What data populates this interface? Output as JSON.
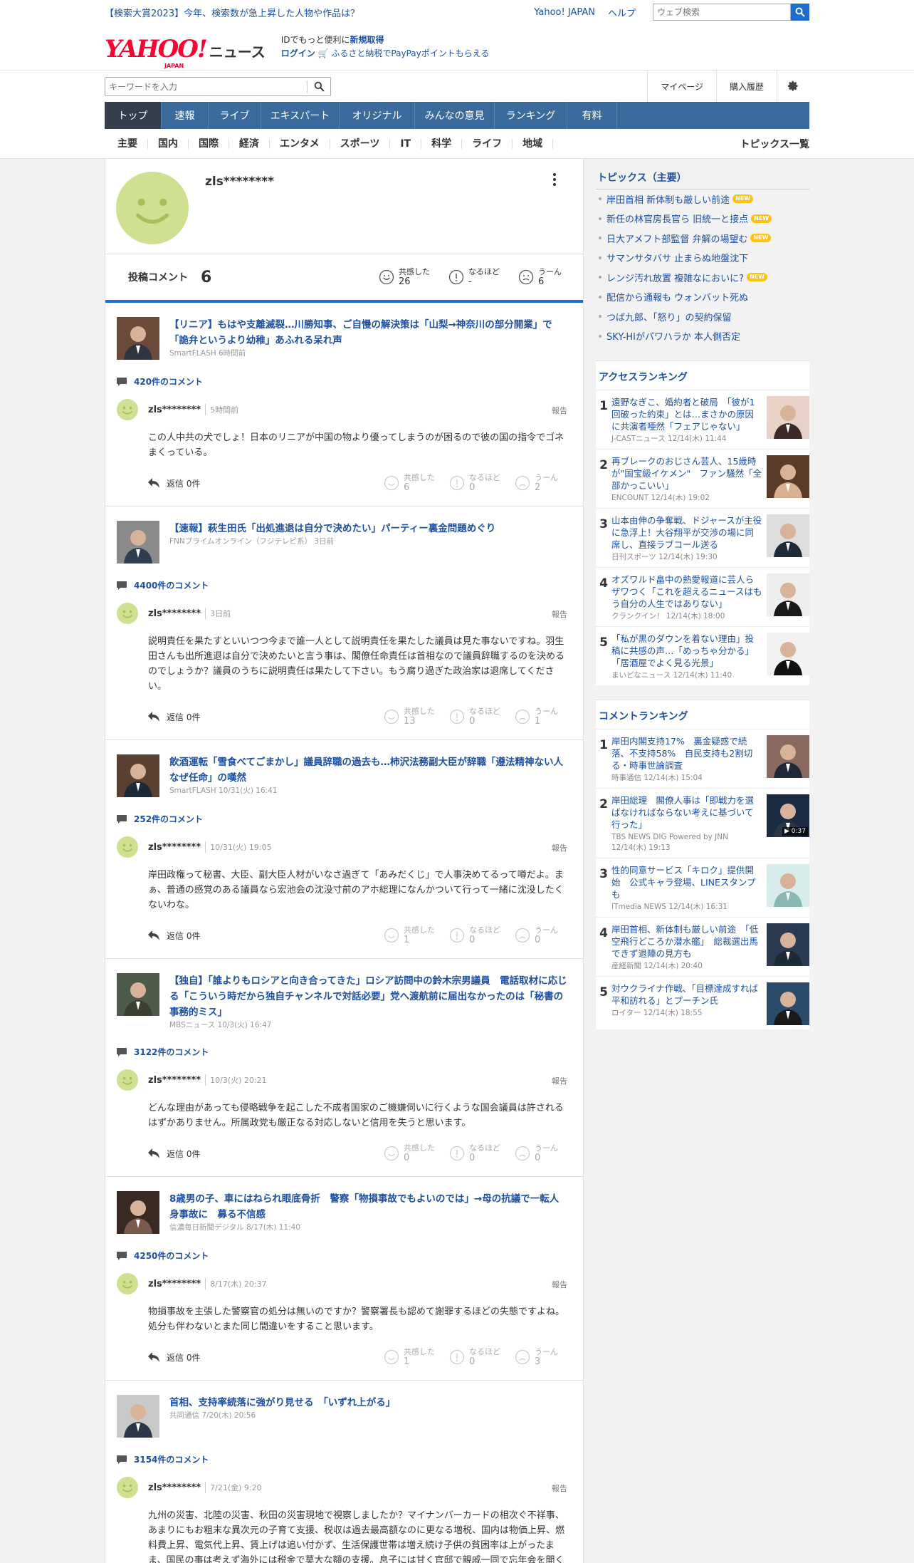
{
  "topbar": {
    "promo": "【検索大賞2023】今年、検索数が急上昇した人物や作品は？",
    "yahoo_japan": "Yahoo! JAPAN",
    "help": "ヘルプ",
    "web_search_placeholder": "ウェブ検索"
  },
  "header": {
    "logo": "YAHOO!",
    "logo_sub": "JAPAN",
    "logo_news": "ニュース",
    "id_line1_pre": "IDでもっと便利に",
    "id_line1_link": "新規取得",
    "login": "ログイン",
    "furusato": "ふるさと納税でPayPayポイントもらえる"
  },
  "search": {
    "placeholder": "キーワードを入力",
    "mypage": "マイページ",
    "history": "購入履歴"
  },
  "nav": {
    "tabs": [
      "トップ",
      "速報",
      "ライブ",
      "エキスパート",
      "オリジナル",
      "みんなの意見",
      "ランキング",
      "有料"
    ]
  },
  "subnav": {
    "items": [
      "主要",
      "国内",
      "国際",
      "経済",
      "エンタメ",
      "スポーツ",
      "IT",
      "科学",
      "ライフ",
      "地域"
    ],
    "more": "トピックス一覧"
  },
  "profile": {
    "name": "zls********",
    "posts_label": "投稿コメント",
    "posts_count": "6",
    "react1_label": "共感した",
    "react1_count": "26",
    "react2_label": "なるほど",
    "react2_count": "-",
    "react3_label": "うーん",
    "react3_count": "6"
  },
  "labels": {
    "report": "報告",
    "reply": "返信 0件",
    "r1": "共感した",
    "r2": "なるほど",
    "r3": "うーん"
  },
  "comments": [
    {
      "title": "【リニア】もはや支離滅裂…川勝知事、ご自慢の解決策は「山梨→神奈川の部分開業」で「詭弁というより幼稚」あふれる呆れ声",
      "source": "SmartFLASH 6時間前",
      "count": "420件のコメント",
      "user": "zls********",
      "time": "5時間前",
      "body": "この人中共の犬でしょ！日本のリニアが中国の物より優ってしまうのが困るので彼の国の指令でゴネまくっている。",
      "n1": "6",
      "n2": "0",
      "n3": "2"
    },
    {
      "title": "【速報】萩生田氏「出処進退は自分で決めたい」パーティー裏金問題めぐり",
      "source": "FNNプライムオンライン（フジテレビ系） 3日前",
      "count": "4400件のコメント",
      "user": "zls********",
      "time": "3日前",
      "body": "説明責任を果たすといいつつ今まで誰一人として説明責任を果たした議員は見た事ないですね。羽生田さんも出所進退は自分で決めたいと言う事は、閣僚任命責任は首相なので議員辞職するのを決めるのでしょうか？議員のうちに説明責任は果たして下さい。もう腐り過ぎた政治家は退席してください。",
      "n1": "13",
      "n2": "0",
      "n3": "1"
    },
    {
      "title": "飲酒運転「雪食べてごまかし」議員辞職の過去も…柿沢法務副大臣が辞職「遵法精神ない人なぜ任命」の嘆然",
      "source": "SmartFLASH 10/31(火) 16:41",
      "count": "252件のコメント",
      "user": "zls********",
      "time": "10/31(火) 19:05",
      "body": "岸田政権って秘書、大臣、副大臣人材がいなさ過ぎて「あみだくじ」で人事決めてるって噂だよ。まぁ、普通の感覚のある議員なら宏池会の沈没寸前のアホ総理になんかついて行って一緒に沈没したくないわな。",
      "n1": "1",
      "n2": "0",
      "n3": "0"
    },
    {
      "title": "【独自】「誰よりもロシアと向き合ってきた」ロシア訪問中の鈴木宗男議員　電話取材に応じる「こういう時だから独自チャンネルで対話必要」党へ渡航前に届出なかったのは「秘書の事務的ミス」",
      "source": "MBSニュース 10/3(火) 16:47",
      "count": "3122件のコメント",
      "user": "zls********",
      "time": "10/3(火) 20:21",
      "body": "どんな理由があっても侵略戦争を起こした不成者国家のご機嫌伺いに行くような国会議員は許されるはずかありません。所属政党も厳正なる対応しないと信用を失うと思います。",
      "n1": "0",
      "n2": "0",
      "n3": "0"
    },
    {
      "title": "8歳男の子、車にはねられ眼底骨折　警察「物損事故でもよいのでは」→母の抗議で一転人身事故に　募る不信感",
      "source": "信濃毎日新聞デジタル 8/17(木) 11:40",
      "count": "4250件のコメント",
      "user": "zls********",
      "time": "8/17(木) 20:37",
      "body": "物損事故を主張した警察官の処分は無いのですか？警察署長も認めて謝罪するほどの失態ですよね。\n処分も伴わないとまた同じ間違いをすること思います。",
      "n1": "1",
      "n2": "0",
      "n3": "3"
    },
    {
      "title": "首相、支持率続落に強がり見せる　「いずれ上がる」",
      "source": "共同通信 7/20(木) 20:56",
      "count": "3154件のコメント",
      "user": "zls********",
      "time": "7/21(金) 9:20",
      "body": "九州の災害、北陸の災害、秋田の災害現地で視察しましたか？マイナンバーカードの相次ぐ不祥事、あまりにもお粗末な異次元の子育て支援、税収は過去最高額なのに更なる増税、国内は物価上昇、燃料費上昇、電気代上昇、賃上げは追い付かず、生活保護世帯は増え続け子供の貧困率は上がったまま、国民の事は考えず海外には税金で莫大な額の支援。息子には甘く官邸で親戚一同で忘年会を開く始末。日本の人口は減りつつ労働人口は年々目に見えて減っているのに議員定数は減らさず議員の文書交通費の使い道にすら手も付けず税金ばかり増やす。できる事なら違う国に亡命したいと思っている人は少なくないと思います。岸田さんもう辞めてく",
      "n1": "",
      "n2": "",
      "n3": ""
    }
  ],
  "topics": {
    "heading": "トピックス（主要）",
    "items": [
      {
        "t": "岸田首相 新体制も厳しい前途",
        "new": true
      },
      {
        "t": "新任の林官房長官ら 旧統一と接点",
        "new": true
      },
      {
        "t": "日大アメフト部監督 弁解の場望む",
        "new": true
      },
      {
        "t": "サマンサタバサ 止まらぬ地盤沈下",
        "new": false
      },
      {
        "t": "レンジ汚れ放置 複雑なにおいに?",
        "new": true
      },
      {
        "t": "配信から通報も ウォンバット死ぬ",
        "new": false
      },
      {
        "t": "つば九郎、「怒り」の契約保留",
        "new": false
      },
      {
        "t": "SKY-HIがパワハラか 本人側否定",
        "new": false
      }
    ],
    "new_label": "NEW"
  },
  "access": {
    "heading": "アクセスランキング",
    "items": [
      {
        "no": "1",
        "t": "遠野なぎこ、婚約者と破局　「彼が1回破った約束」とは…まさかの原因に共演者唖然「フェアじゃない」",
        "s": "J-CASTニュース 12/14(木) 11:44"
      },
      {
        "no": "2",
        "t": "再ブレークのおじさん芸人、15歳時が\"国宝級イケメン\"　ファン騒然「全部かっこいい」",
        "s": "ENCOUNT 12/14(木) 19:02"
      },
      {
        "no": "3",
        "t": "山本由伸の争奪戦、ドジャースが主役に急浮上！大谷翔平が交渉の場に同席し、直接ラブコール送る",
        "s": "日刊スポーツ 12/14(木) 19:30"
      },
      {
        "no": "4",
        "t": "オズワルド畠中の熱愛報道に芸人らザワつく「これを超えるニュースはもう自分の人生ではありない」",
        "s": "クランクイン！ 12/14(木) 18:00"
      },
      {
        "no": "5",
        "t": "「私が黒のダウンを着ない理由」投稿に共感の声…「めっちゃ分かる」「居酒屋でよく見る光景」",
        "s": "まいどなニュース 12/14(木) 11:40"
      }
    ]
  },
  "commentrank": {
    "heading": "コメントランキング",
    "items": [
      {
        "no": "1",
        "t": "岸田内閣支持17%　裏金疑惑で続落、不支持58%　自民支持も2割切る・時事世論調査",
        "s": "時事通信 12/14(木) 15:04"
      },
      {
        "no": "2",
        "t": "岸田総理　閣僚人事は「即戦力を選ばなければならない考えに基づいて行った」",
        "s": "TBS NEWS DIG Powered by JNN 12/14(木) 19:13",
        "video": "▶ 0:37"
      },
      {
        "no": "3",
        "t": "性的同意サービス「キロク」提供開始　公式キャラ登場、LINEスタンプも",
        "s": "ITmedia NEWS 12/14(木) 16:31"
      },
      {
        "no": "4",
        "t": "岸田首相、新体制も厳しい前途　「低空飛行どころか潜水艦」　総裁選出馬できず退陣の見方も",
        "s": "産経新聞 12/14(木) 20:40"
      },
      {
        "no": "5",
        "t": "対ウクライナ作戦、「目標達成すれば平和訪れる」とプーチン氏",
        "s": "ロイター 12/14(木) 18:55"
      }
    ]
  }
}
